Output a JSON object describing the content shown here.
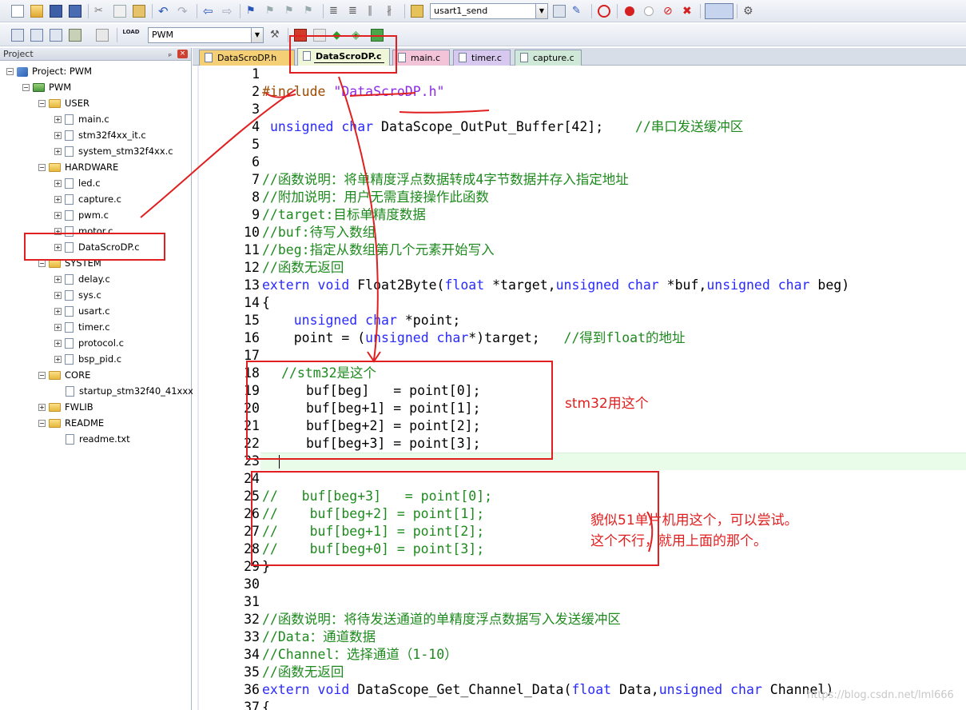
{
  "toolbar1": {
    "target_combo": "usart1_send"
  },
  "toolbar2": {
    "project_combo": "PWM",
    "load_label": "LOAD"
  },
  "project_panel": {
    "title": "Project",
    "pin_glyph": "ₚ",
    "close_glyph": "×",
    "rows": [
      {
        "label": "Project: PWM"
      },
      {
        "label": "PWM"
      },
      {
        "label": "USER"
      },
      {
        "label": "main.c"
      },
      {
        "label": "stm32f4xx_it.c"
      },
      {
        "label": "system_stm32f4xx.c"
      },
      {
        "label": "HARDWARE"
      },
      {
        "label": "led.c"
      },
      {
        "label": "capture.c"
      },
      {
        "label": "pwm.c"
      },
      {
        "label": "motor.c"
      },
      {
        "label": "DataScroDP.c"
      },
      {
        "label": "SYSTEM"
      },
      {
        "label": "delay.c"
      },
      {
        "label": "sys.c"
      },
      {
        "label": "usart.c"
      },
      {
        "label": "timer.c"
      },
      {
        "label": "protocol.c"
      },
      {
        "label": "bsp_pid.c"
      },
      {
        "label": "CORE"
      },
      {
        "label": "startup_stm32f40_41xxx.s"
      },
      {
        "label": "FWLIB"
      },
      {
        "label": "README"
      },
      {
        "label": "readme.txt"
      }
    ]
  },
  "tabs": [
    {
      "label": "DataScroDP.h"
    },
    {
      "label": "DataScroDP.c"
    },
    {
      "label": "main.c"
    },
    {
      "label": "timer.c"
    },
    {
      "label": "capture.c"
    }
  ],
  "code": {
    "line_numbers": [
      "1",
      "2",
      "3",
      "4",
      "5",
      "6",
      "7",
      "8",
      "9",
      "10",
      "11",
      "12",
      "13",
      "14",
      "15",
      "16",
      "17",
      "18",
      "19",
      "20",
      "21",
      "22",
      "23",
      "24",
      "25",
      "26",
      "27",
      "28",
      "29",
      "30",
      "31",
      "32",
      "33",
      "34",
      "35",
      "36",
      "37"
    ],
    "l2_pp": "#include ",
    "l2_str": "\"DataScroDP.h\"",
    "l4_kw": "unsigned char",
    "l4_rest": " DataScope_OutPut_Buffer[42];    ",
    "l4_cm": "//串口发送缓冲区",
    "l7": "//函数说明：将单精度浮点数据转成4字节数据并存入指定地址",
    "l8": "//附加说明：用户无需直接操作此函数",
    "l9": "//target:目标单精度数据",
    "l10": "//buf:待写入数组",
    "l11": "//beg:指定从数组第几个元素开始写入",
    "l12": "//函数无返回",
    "l13_kw1": "extern void",
    "l13_a": " Float2Byte(",
    "l13_kw2": "float",
    "l13_b": " *target,",
    "l13_kw3": "unsigned char",
    "l13_c": " *buf,",
    "l13_kw4": "unsigned char",
    "l13_d": " beg)",
    "l14": "{",
    "l15_kw": "unsigned char",
    "l15_rest": " *point;",
    "l16_a": "point = (",
    "l16_kw": "unsigned char",
    "l16_b": "*)target;   ",
    "l16_cm": "//得到float的地址",
    "l18": "//stm32是这个",
    "l19": "buf[beg]   = point[0];",
    "l20": "buf[beg+1] = point[1];",
    "l21": "buf[beg+2] = point[2];",
    "l22": "buf[beg+3] = point[3];",
    "l25": "//   buf[beg+3]   = point[0];",
    "l26": "//    buf[beg+2] = point[1];",
    "l27": "//    buf[beg+1] = point[2];",
    "l28": "//    buf[beg+0] = point[3];",
    "l29": "}",
    "l32": "//函数说明：将待发送通道的单精度浮点数据写入发送缓冲区",
    "l33": "//Data：通道数据",
    "l34": "//Channel：选择通道（1-10）",
    "l35": "//函数无返回",
    "l36_kw1": "extern void",
    "l36_a": " DataScope_Get_Channel_Data(",
    "l36_kw2": "float",
    "l36_b": " Data,",
    "l36_kw3": "unsigned char",
    "l36_c": " Channel)",
    "l37": "{"
  },
  "annotations": {
    "stm32": "stm32用这个",
    "mcs51_line1": "貌似51单片机用这个，可以尝试。",
    "mcs51_line2": "这个不行，就用上面的那个。"
  },
  "watermark": "https://blog.csdn.net/lml666",
  "colors": {
    "keyword": "#2a2aff",
    "comment": "#1e8a1e",
    "annotation": "#e02020",
    "current_line": "#e9fbe9"
  }
}
